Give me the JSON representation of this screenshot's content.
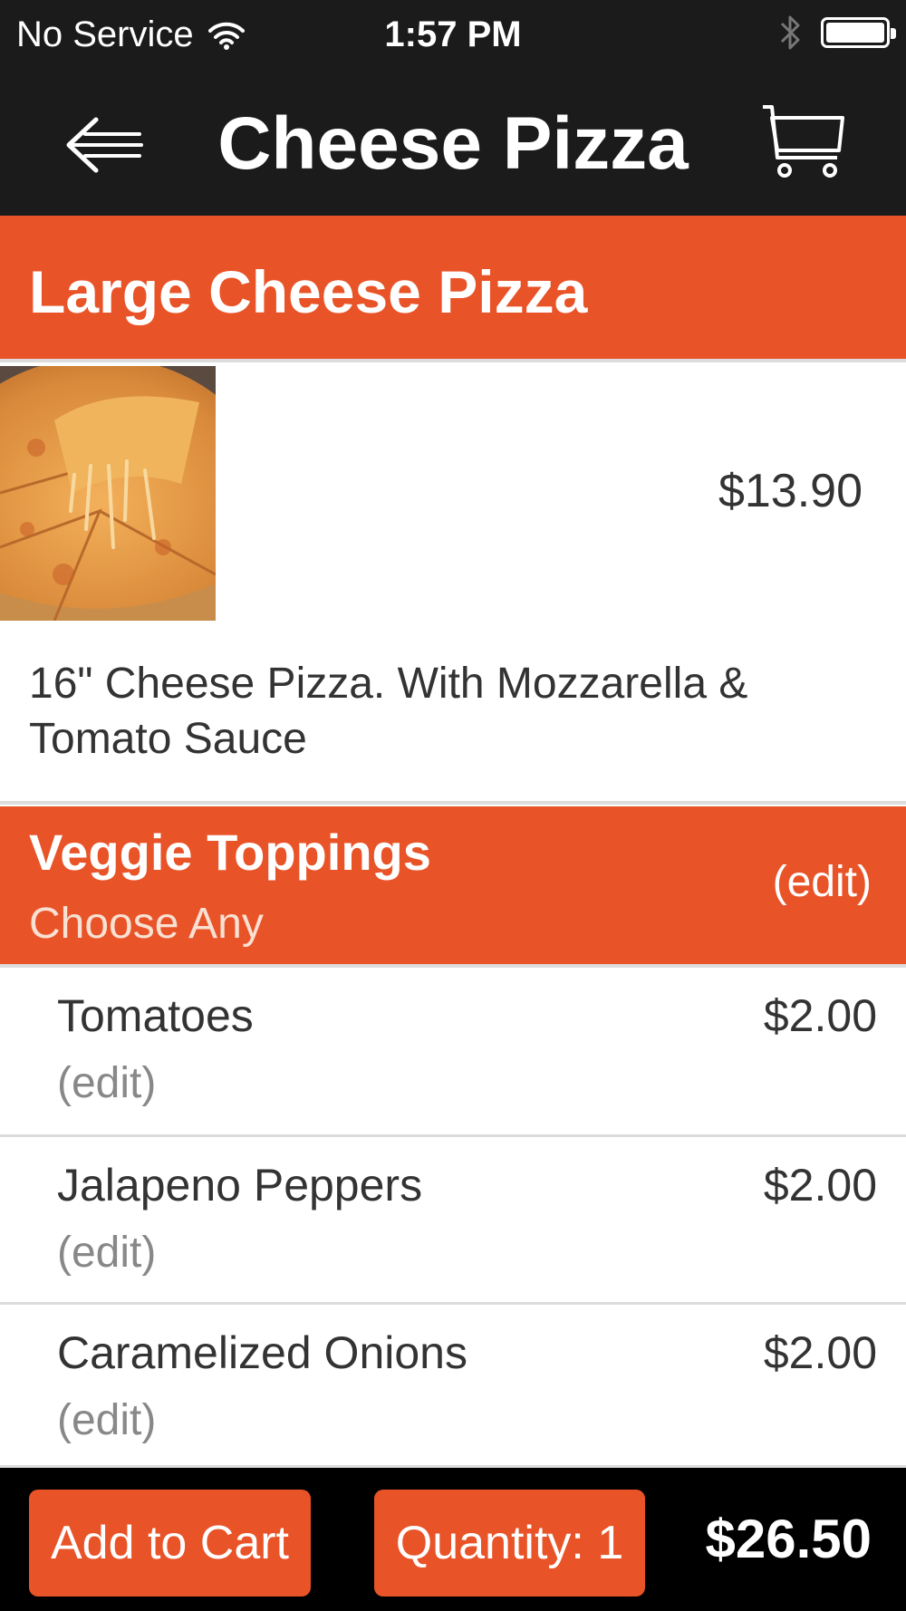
{
  "status_bar": {
    "carrier": "No Service",
    "time": "1:57 PM"
  },
  "nav": {
    "title": "Cheese Pizza",
    "back_icon": "back-arrow-icon",
    "cart_icon": "shopping-cart-icon"
  },
  "product": {
    "name": "Large Cheese Pizza",
    "price": "$13.90",
    "description": "16\" Cheese Pizza. With Mozzarella & Tomato Sauce",
    "image": "cheese-pizza-photo"
  },
  "option_group": {
    "title": "Veggie Toppings",
    "subtitle": "Choose Any",
    "edit_label": "(edit)",
    "items": [
      {
        "name": "Tomatoes",
        "price": "$2.00",
        "edit_label": "(edit)"
      },
      {
        "name": "Jalapeno Peppers",
        "price": "$2.00",
        "edit_label": "(edit)"
      },
      {
        "name": "Caramelized Onions",
        "price": "$2.00",
        "edit_label": "(edit)"
      }
    ]
  },
  "bottom_bar": {
    "add_to_cart_label": "Add to Cart",
    "quantity_label": "Quantity: 1",
    "total": "$26.50"
  },
  "colors": {
    "accent": "#e95328",
    "bar": "#1b1b1b",
    "bottom_bar": "#000000"
  }
}
